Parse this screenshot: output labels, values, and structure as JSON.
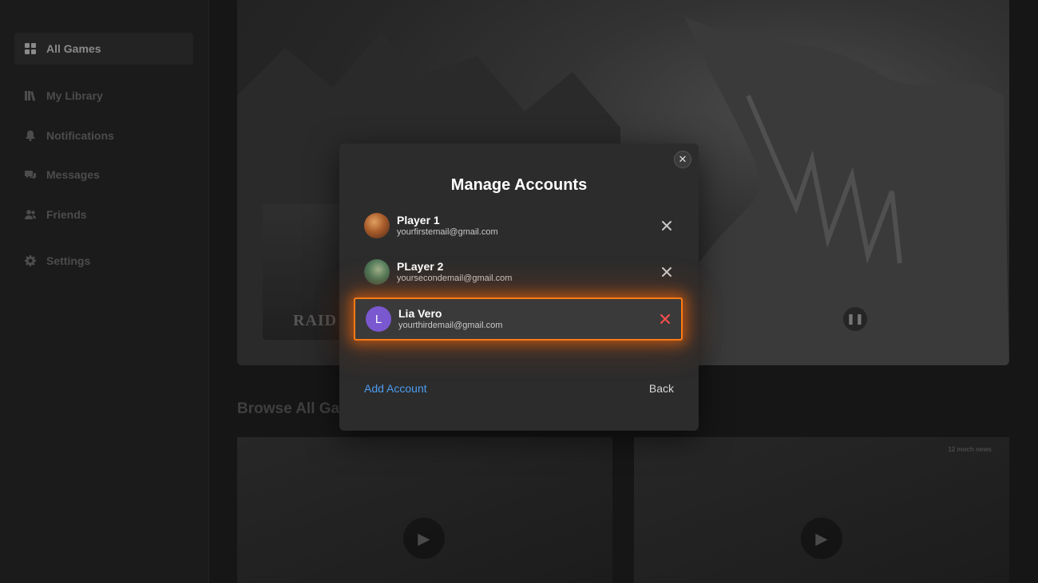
{
  "sidebar": {
    "items": [
      {
        "label": "All Games",
        "icon": "grid-icon",
        "active": true
      },
      {
        "label": "My Library",
        "icon": "library-icon"
      },
      {
        "label": "Notifications",
        "icon": "bell-icon"
      },
      {
        "label": "Messages",
        "icon": "chat-icon"
      },
      {
        "label": "Friends",
        "icon": "friends-icon"
      },
      {
        "label": "Settings",
        "icon": "gear-icon"
      }
    ]
  },
  "main": {
    "hero_card_text": "RAID",
    "browse_title": "Browse All Games",
    "news_brand": "12 moch news"
  },
  "modal": {
    "title": "Manage Accounts",
    "close_icon": "close-icon",
    "accounts": [
      {
        "name": "Player 1",
        "email": "yourfirstemail@gmail.com",
        "avatar": "portrait-avatar"
      },
      {
        "name": "PLayer 2",
        "email": "yoursecondemail@gmail.com",
        "avatar": "portrait-avatar"
      },
      {
        "name": "Lia Vero",
        "email": "yourthirdemail@gmail.com",
        "avatar_initial": "L",
        "selected": true
      }
    ],
    "add_account_label": "Add Account",
    "back_label": "Back"
  },
  "colors": {
    "accent_orange": "#ff7a14",
    "link_blue": "#4d9df0",
    "remove_red": "#ff4d4d",
    "avatar_purple": "#7a58cf"
  }
}
